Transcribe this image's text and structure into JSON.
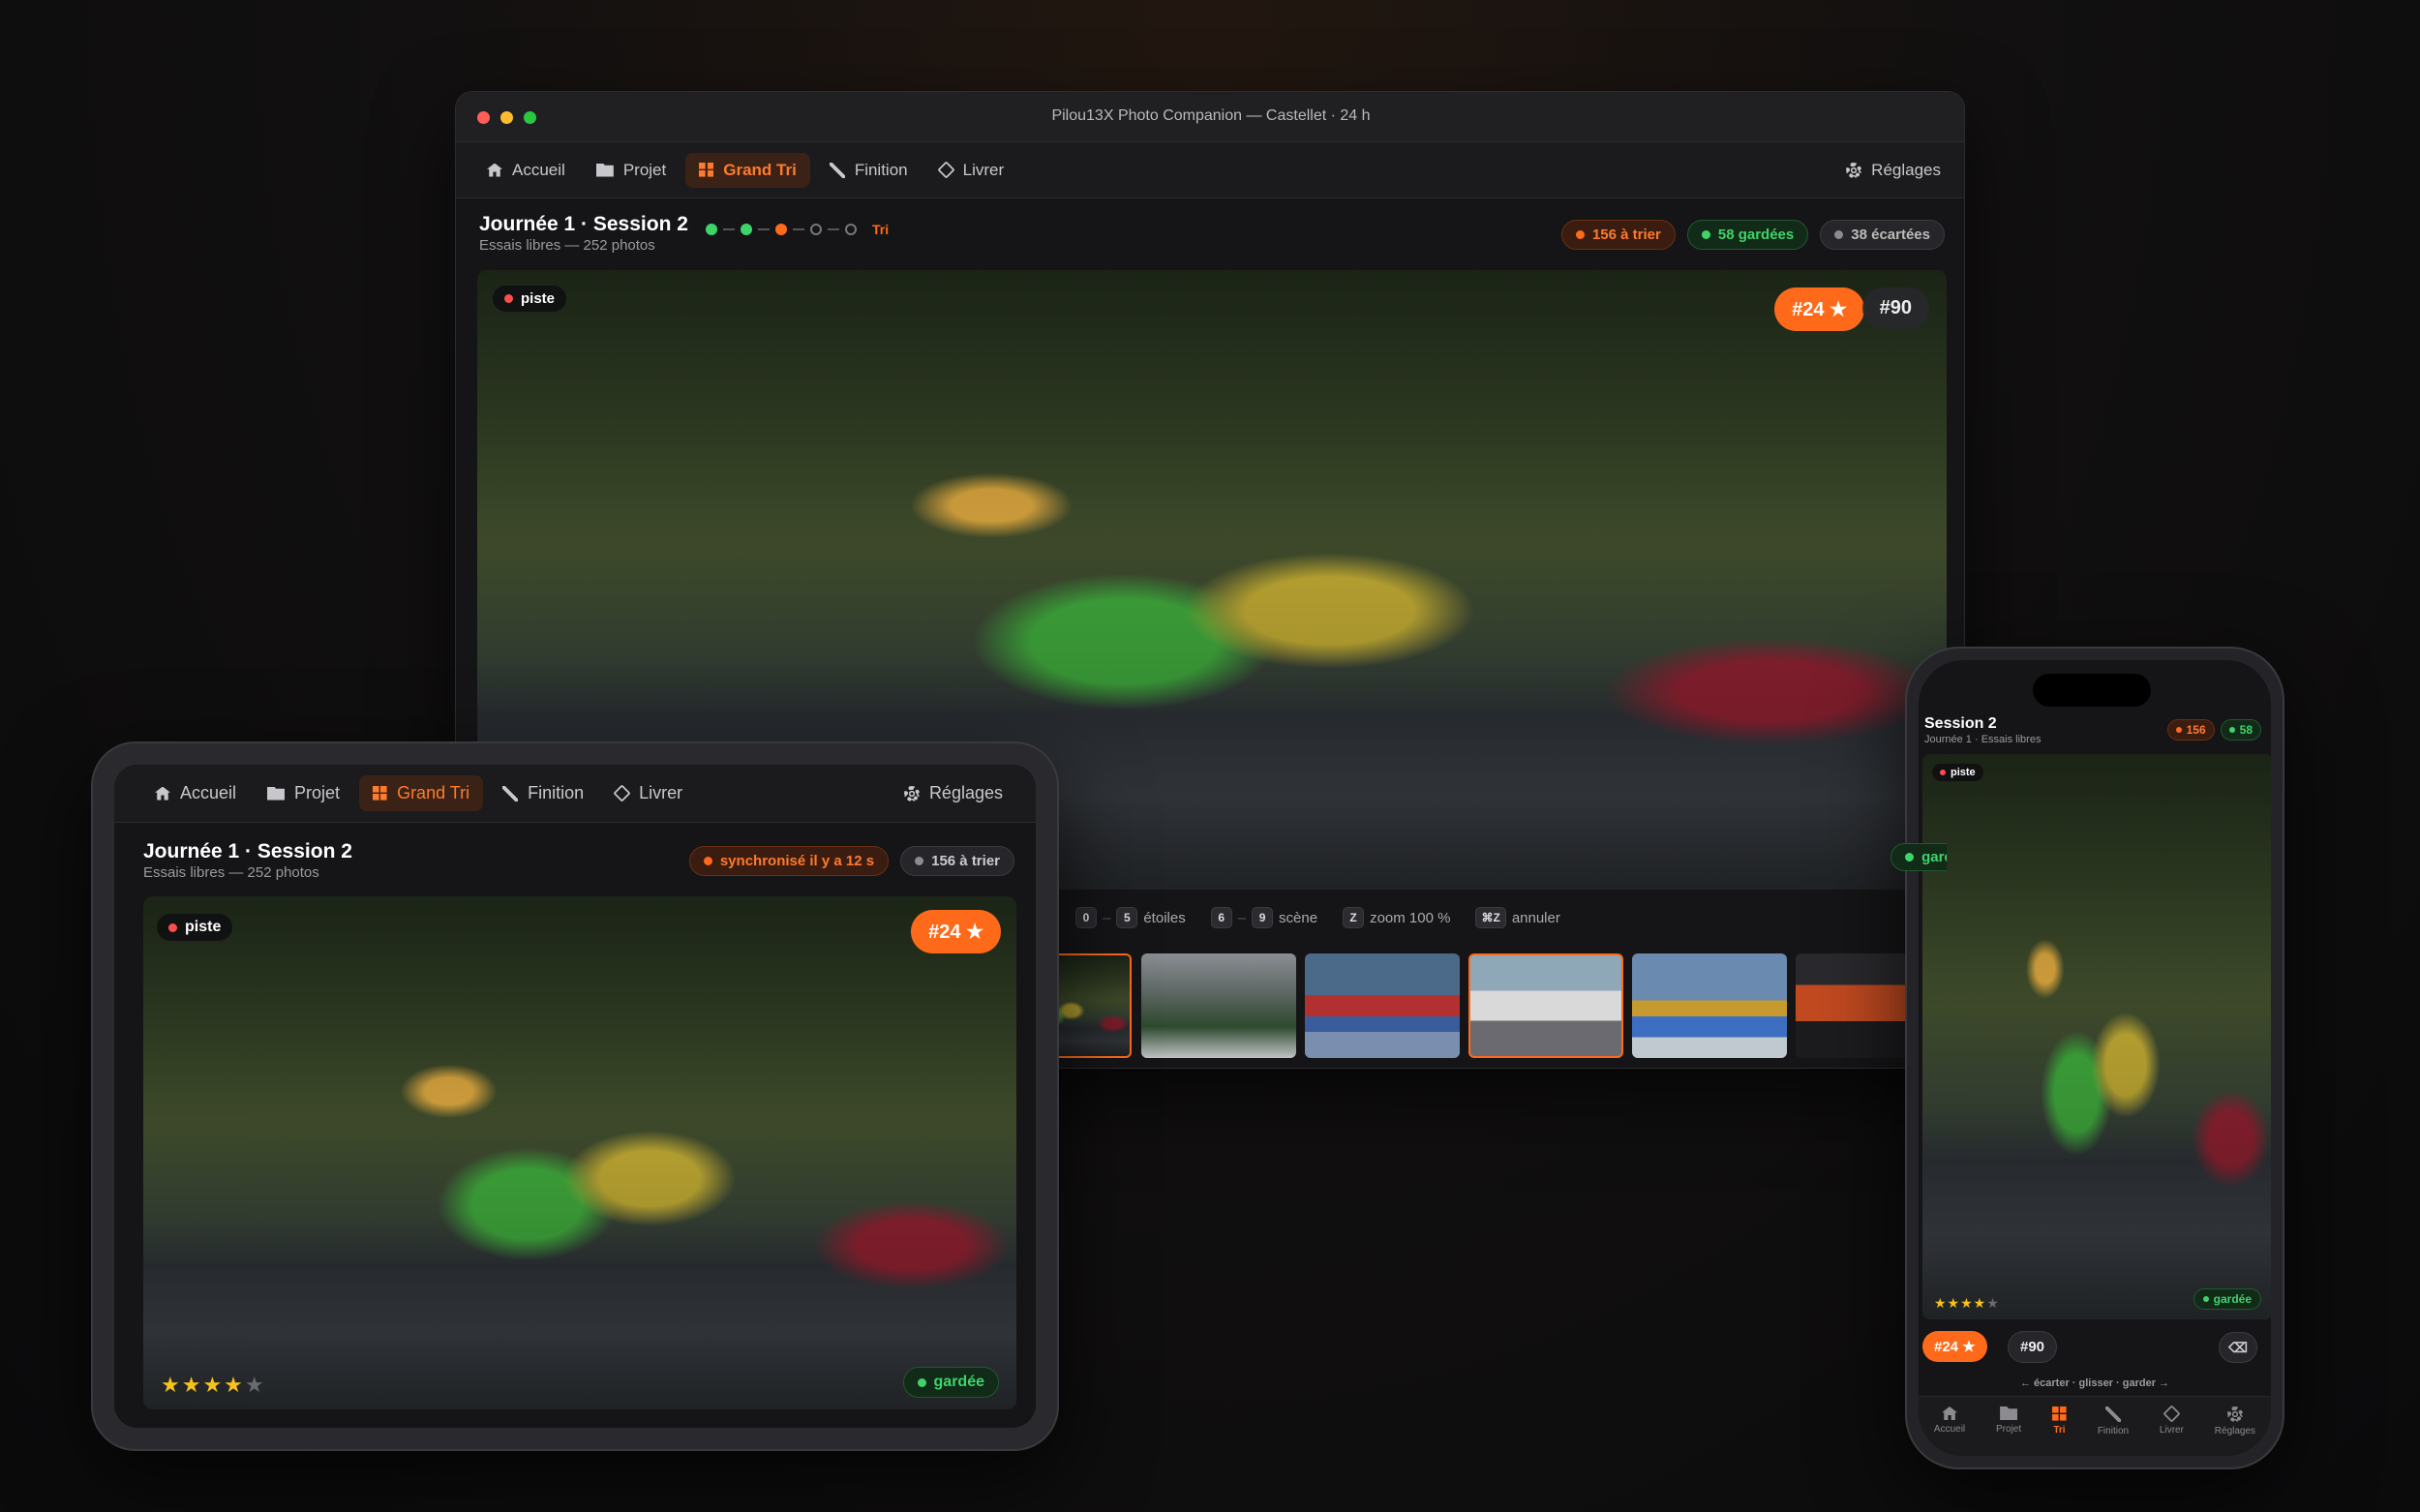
{
  "desktop": {
    "window_title": "Pilou13X Photo Companion — Castellet · 24 h",
    "nav": [
      "Accueil",
      "Projet",
      "Grand Tri",
      "Finition",
      "Livrer"
    ],
    "settings": "Réglages",
    "session_title": "Journée 1 · Session 2",
    "session_sub": "Essais libres — 252 photos",
    "progress_label": "Tri",
    "badges": {
      "to_sort": "156 à trier",
      "kept": "58 gardées",
      "rejected": "38 écartées"
    },
    "photo_tag": "piste",
    "num_primary": "#24 ★",
    "num_secondary": "#90",
    "kept_partial": "gardé",
    "shortcuts": {
      "k1": "0",
      "k2": "5",
      "stars": "étoiles",
      "k3": "6",
      "k4": "9",
      "scene": "scène",
      "kz": "Z",
      "zoom": "zoom 100 %",
      "kundo": "⌘Z",
      "undo": "annuler"
    }
  },
  "tablet": {
    "nav": [
      "Accueil",
      "Projet",
      "Grand Tri",
      "Finition",
      "Livrer"
    ],
    "settings": "Réglages",
    "session_title": "Journée 1 · Session 2",
    "session_sub": "Essais libres — 252 photos",
    "sync": "synchronisé il y a 12 s",
    "to_sort": "156 à trier",
    "photo_tag": "piste",
    "num": "#24 ★",
    "stars": "★★★★",
    "star_empty": "★",
    "rating": 4,
    "kept": "gardée"
  },
  "phone": {
    "session_title": "Session 2",
    "session_sub": "Journée 1 · Essais libres",
    "badge_to_sort": "156",
    "badge_kept": "58",
    "photo_tag": "piste",
    "stars": "★★★★",
    "star_empty": "★",
    "rating": 4,
    "kept": "gardée",
    "num_primary": "#24 ★",
    "num_secondary": "#90",
    "hint": "← écarter · glisser · garder →",
    "tabs": [
      "Accueil",
      "Projet",
      "Tri",
      "Finition",
      "Livrer",
      "Réglages"
    ]
  },
  "colors": {
    "accent": "#ff6a1a",
    "green": "#3fd46a",
    "red": "#ff4d4d",
    "gray": "#8b8b90",
    "star": "#f6c21c"
  }
}
